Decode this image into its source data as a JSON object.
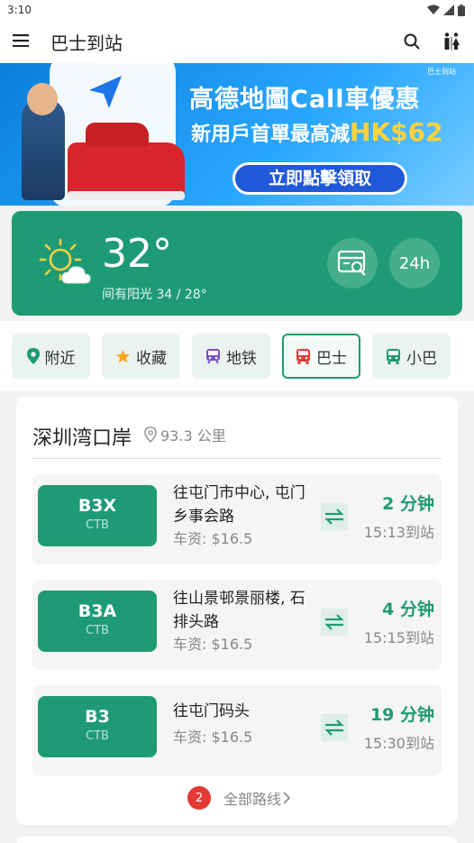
{
  "status": {
    "time": "3:10"
  },
  "appbar": {
    "title": "巴士到站",
    "icons": [
      "menu-icon",
      "search-icon",
      "restroom-icon"
    ]
  },
  "banner": {
    "brand": "巴士到站",
    "line1": "高德地圖Call車優惠",
    "line2_prefix": "新用戶首單最高減",
    "line2_highlight": "HK$62",
    "cta": "立即點擊領取"
  },
  "weather": {
    "temperature": "32°",
    "description": "间有阳光 34 / 28°",
    "hours_button": "24h",
    "icon": "partly-sunny-icon"
  },
  "tabs": [
    {
      "label": "附近",
      "icon": "location-icon",
      "color": "#1e9b75"
    },
    {
      "label": "收藏",
      "icon": "star-icon",
      "color": "#f5a623"
    },
    {
      "label": "地铁",
      "icon": "subway-icon",
      "color": "#7b4fc9"
    },
    {
      "label": "巴士",
      "icon": "bus-icon",
      "color": "#e53935"
    },
    {
      "label": "小巴",
      "icon": "minibus-icon",
      "color": "#1e9b75"
    }
  ],
  "stop": {
    "name": "深圳湾口岸",
    "distance": "93.3 公里",
    "routes": [
      {
        "number": "B3X",
        "company": "CTB",
        "destination": "往屯门市中心, 屯门乡事会路",
        "fare": "车资: $16.5",
        "eta": "2 分钟",
        "arrival": "15:13到站"
      },
      {
        "number": "B3A",
        "company": "CTB",
        "destination": "往山景邨景丽楼, 石排头路",
        "fare": "车资: $16.5",
        "eta": "4 分钟",
        "arrival": "15:15到站"
      },
      {
        "number": "B3",
        "company": "CTB",
        "destination": "往屯门码头",
        "fare": "车资: $16.5",
        "eta": "19 分钟",
        "arrival": "15:30到站"
      }
    ],
    "more_count": "2",
    "all_routes_label": "全部路线"
  },
  "colors": {
    "primary": "#1e9b75",
    "alert": "#e53935"
  }
}
